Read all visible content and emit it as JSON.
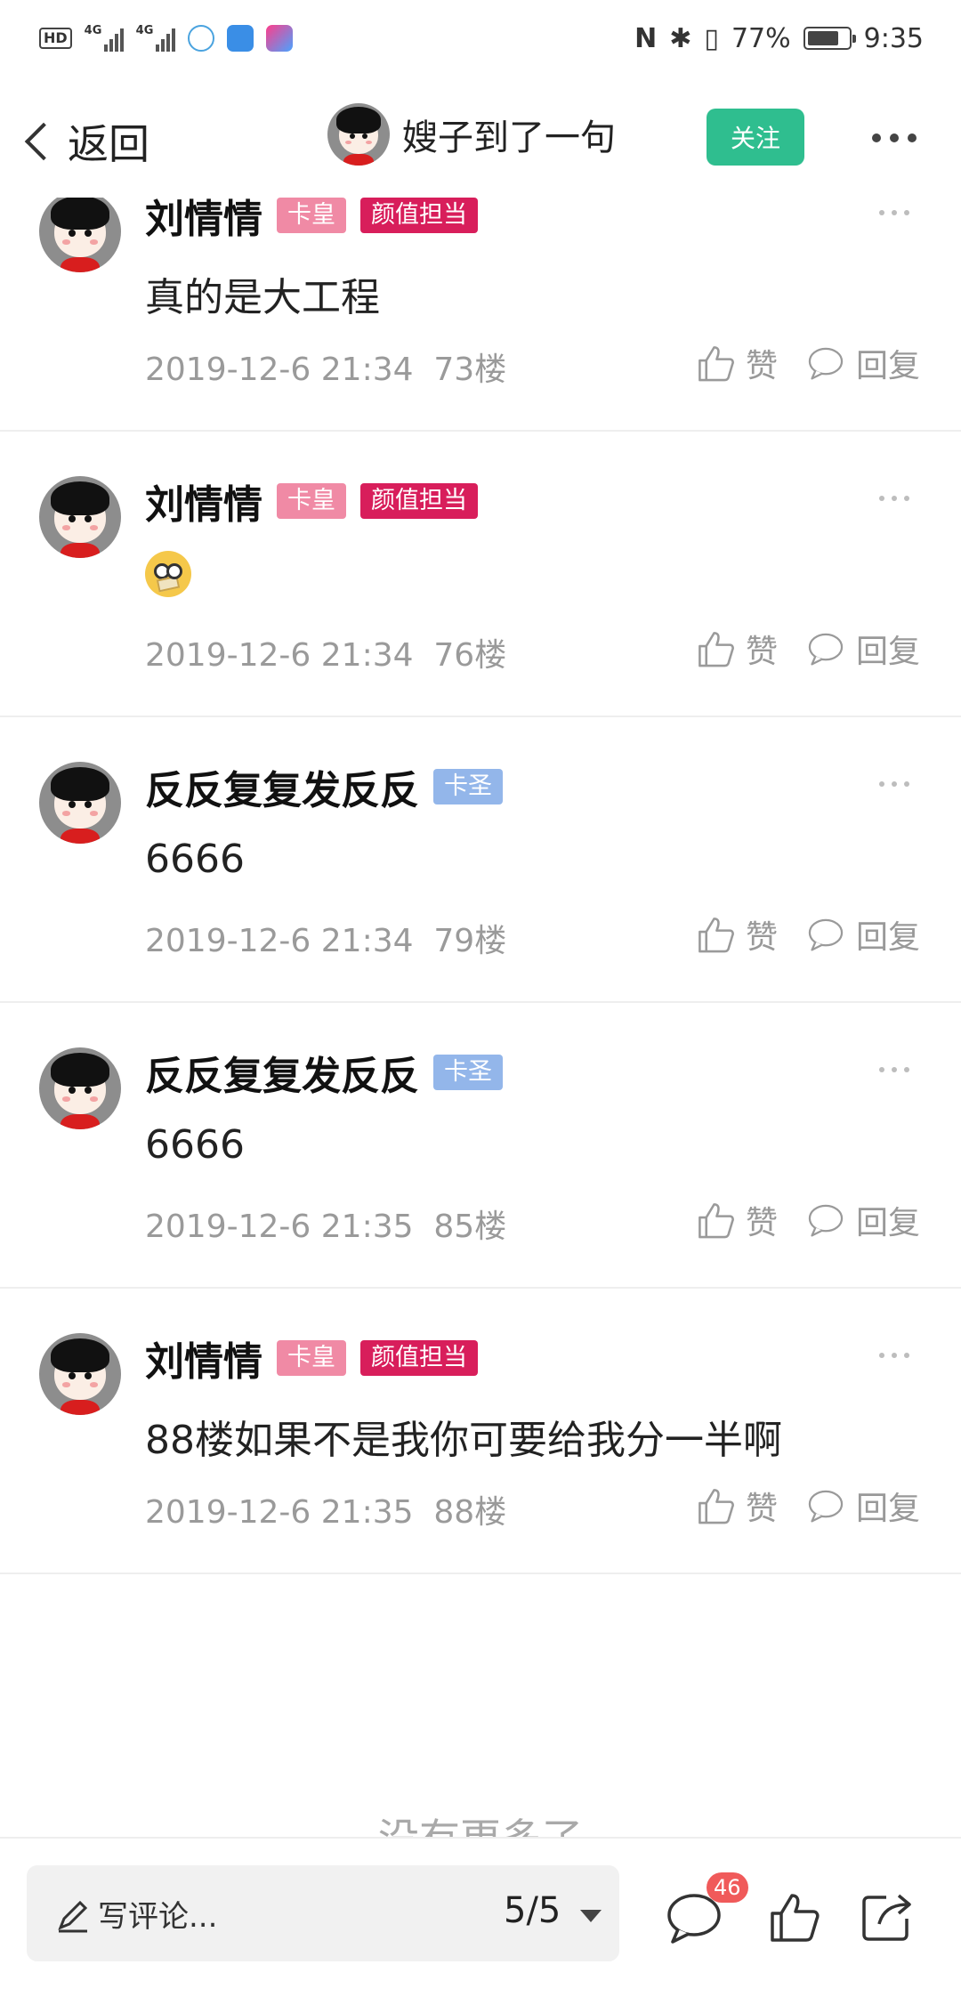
{
  "status_bar": {
    "hd": "HD",
    "net1": "4G",
    "net2": "4G",
    "battery": "77%",
    "battery_level": 0.77,
    "time": "9:35"
  },
  "header": {
    "back_label": "返回",
    "title": "嫂子到了一句",
    "follow_label": "关注"
  },
  "comments": [
    {
      "name": "刘情情",
      "badges": [
        "卡皇",
        "颜值担当"
      ],
      "text": "真的是大工程",
      "time": "2019-12-6 21:34",
      "floor": "73楼",
      "like": "赞",
      "reply": "回复"
    },
    {
      "name": "刘情情",
      "badges": [
        "卡皇",
        "颜值担当"
      ],
      "text": "",
      "time": "2019-12-6 21:34",
      "floor": "76楼",
      "like": "赞",
      "reply": "回复"
    },
    {
      "name": "反反复复发反反",
      "badges": [
        "卡圣"
      ],
      "text": "6666",
      "time": "2019-12-6 21:34",
      "floor": "79楼",
      "like": "赞",
      "reply": "回复"
    },
    {
      "name": "反反复复发反反",
      "badges": [
        "卡圣"
      ],
      "text": "6666",
      "time": "2019-12-6 21:35",
      "floor": "85楼",
      "like": "赞",
      "reply": "回复"
    },
    {
      "name": "刘情情",
      "badges": [
        "卡皇",
        "颜值担当"
      ],
      "text": "88楼如果不是我你可要给我分一半啊",
      "time": "2019-12-6 21:35",
      "floor": "88楼",
      "like": "赞",
      "reply": "回复"
    }
  ],
  "no_more": "没有更多了",
  "bottom_bar": {
    "write_placeholder": "写评论...",
    "page": "5/5",
    "comment_count": "46"
  },
  "colors": {
    "follow": "#2fbe8f",
    "badge_kahuang": "#f08aa5",
    "badge_yanzhi": "#d81e5b",
    "badge_kasheng": "#93b6ea",
    "count_badge": "#f05a5a"
  }
}
